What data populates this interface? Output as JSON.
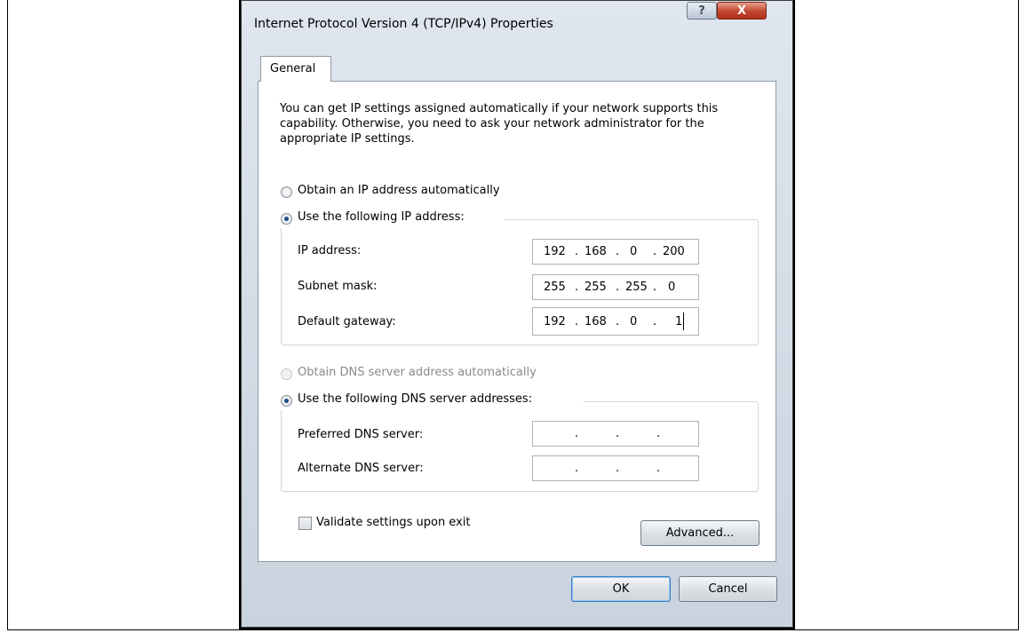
{
  "window": {
    "title": "Internet Protocol Version 4 (TCP/IPv4) Properties",
    "help_label": "?",
    "close_label": "X"
  },
  "tabs": [
    {
      "label": "General",
      "selected": true
    }
  ],
  "general": {
    "intro": "You can get IP settings assigned automatically if your network supports this capability. Otherwise, you need to ask your network administrator for the appropriate IP settings.",
    "obtain_ip_label": "Obtain an IP address automatically",
    "use_ip_label": "Use the following IP address:",
    "ip_mode": "manual",
    "ip_address_label": "IP address:",
    "ip_address": [
      "192",
      "168",
      "0",
      "200"
    ],
    "subnet_label": "Subnet mask:",
    "subnet": [
      "255",
      "255",
      "255",
      "0"
    ],
    "gateway_label": "Default gateway:",
    "gateway": [
      "192",
      "168",
      "0",
      "1"
    ],
    "obtain_dns_label": "Obtain DNS server address automatically",
    "use_dns_label": "Use the following DNS server addresses:",
    "dns_mode": "manual",
    "preferred_dns_label": "Preferred DNS server:",
    "preferred_dns": [
      "",
      "",
      "",
      ""
    ],
    "alternate_dns_label": "Alternate DNS server:",
    "alternate_dns": [
      "",
      "",
      "",
      ""
    ],
    "validate_label": "Validate settings upon exit",
    "validate_checked": false,
    "advanced_label": "Advanced..."
  },
  "footer": {
    "ok_label": "OK",
    "cancel_label": "Cancel"
  },
  "colors": {
    "dialog_bg": "#dfe6ee",
    "close_button": "#c0452d",
    "radio_selected": "#1c4d84"
  }
}
